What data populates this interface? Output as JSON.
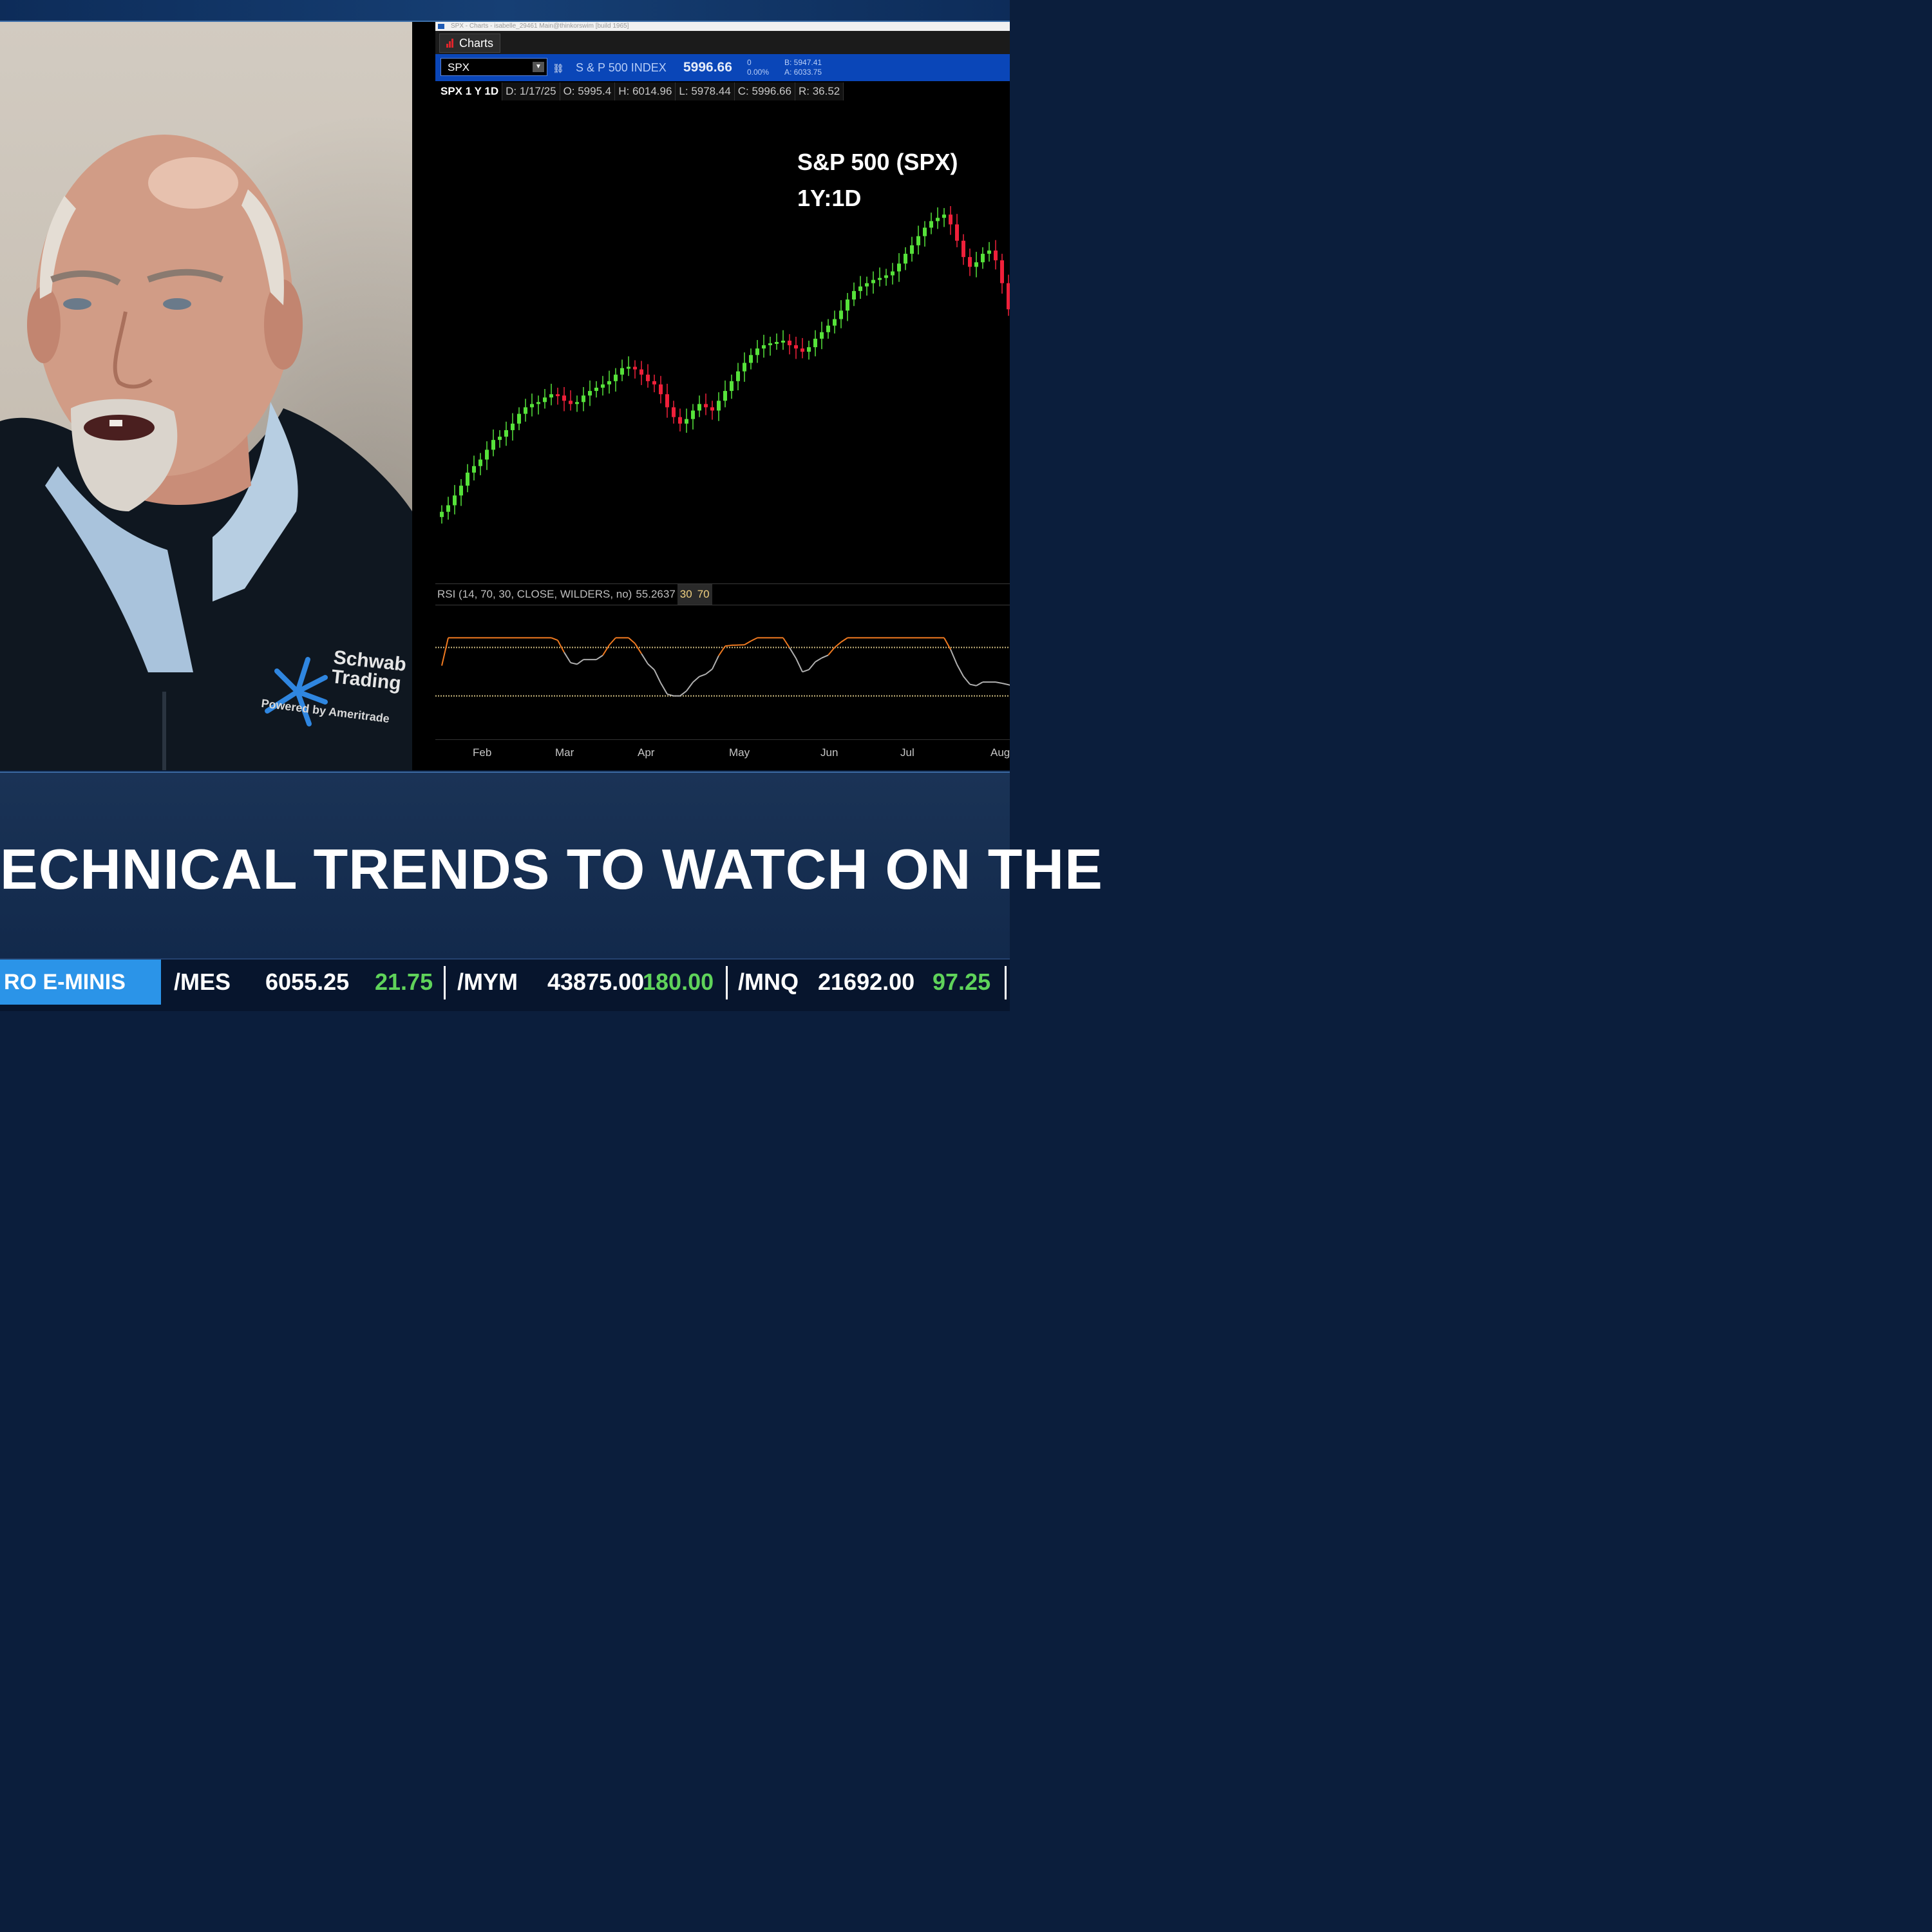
{
  "window": {
    "title_bar": "SPX - Charts - isabelle_29461 Main@thinkorswim [build 1965]"
  },
  "tabs": {
    "charts_label": "Charts"
  },
  "symbol_bar": {
    "symbol": "SPX",
    "description": "S & P 500 INDEX",
    "last": "5996.66",
    "change": "0",
    "change_pct": "0.00%",
    "bid": "B: 5947.41",
    "ask": "A: 6033.75"
  },
  "ohlc": {
    "ticker": "SPX 1 Y 1D",
    "date": "D: 1/17/25",
    "open": "O: 5995.4",
    "high": "H: 6014.96",
    "low": "L: 5978.44",
    "close": "C: 5996.66",
    "range": "R: 36.52"
  },
  "overlay": {
    "line1": "S&P 500 (SPX)",
    "line2": "1Y:1D"
  },
  "rsi": {
    "label": "RSI (14, 70, 30, CLOSE, WILDERS, no)",
    "value": "55.2637",
    "low_level": "30",
    "high_level": "70"
  },
  "x_axis": [
    "Feb",
    "Mar",
    "Apr",
    "May",
    "Jun",
    "Jul",
    "Aug"
  ],
  "headline": "ECHNICAL TRENDS TO WATCH ON THE",
  "ticker_strip": {
    "label": "RO E-MINIS",
    "items": [
      {
        "symbol": "/MES",
        "price": "6055.25",
        "change": "21.75"
      },
      {
        "symbol": "/MYM",
        "price": "43875.00",
        "change": "180.00"
      },
      {
        "symbol": "/MNQ",
        "price": "21692.00",
        "change": "97.25"
      }
    ]
  },
  "video": {
    "logo_line1": "Schwab",
    "logo_line2": "Trading",
    "logo_line3": "Powered by Ameritrade"
  },
  "colors": {
    "up_candle": "#56e23a",
    "down_candle": "#f0203a",
    "rsi_over": "#f07a20",
    "rsi_line": "#b0b0b0",
    "accent_blue": "#2b94e8"
  },
  "chart_data": {
    "type": "candlestick",
    "timeframe": "1Y:1D",
    "close_series": [
      5790,
      5800,
      5815,
      5830,
      5850,
      5860,
      5870,
      5885,
      5900,
      5905,
      5915,
      5925,
      5940,
      5950,
      5955,
      5958,
      5965,
      5970,
      5968,
      5960,
      5955,
      5958,
      5968,
      5975,
      5980,
      5985,
      5990,
      6000,
      6010,
      6012,
      6008,
      6000,
      5990,
      5985,
      5970,
      5950,
      5935,
      5925,
      5932,
      5945,
      5955,
      5950,
      5945,
      5960,
      5975,
      5990,
      6005,
      6018,
      6030,
      6040,
      6045,
      6048,
      6050,
      6052,
      6045,
      6040,
      6035,
      6042,
      6055,
      6065,
      6075,
      6085,
      6098,
      6115,
      6128,
      6135,
      6140,
      6145,
      6148,
      6152,
      6158,
      6170,
      6185,
      6198,
      6212,
      6225,
      6235,
      6240,
      6245,
      6230,
      6205,
      6180,
      6165,
      6172,
      6185,
      6190,
      6175,
      6140,
      6100,
      6060,
      6050,
      6065
    ]
  }
}
